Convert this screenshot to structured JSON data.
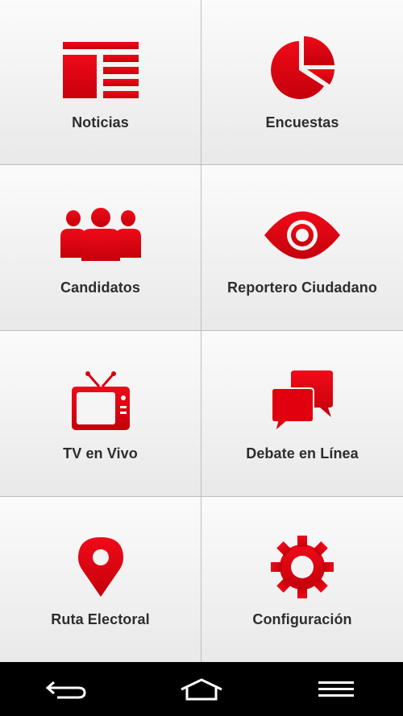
{
  "colors": {
    "accent": "#e3000f",
    "text": "#2d2d2d",
    "navbar": "#000000"
  },
  "tiles": [
    {
      "label": "Noticias",
      "icon": "newspaper-icon"
    },
    {
      "label": "Encuestas",
      "icon": "pie-chart-icon"
    },
    {
      "label": "Candidatos",
      "icon": "people-group-icon"
    },
    {
      "label": "Reportero Ciudadano",
      "icon": "eye-icon"
    },
    {
      "label": "TV en Vivo",
      "icon": "tv-icon"
    },
    {
      "label": "Debate en Línea",
      "icon": "chat-bubbles-icon"
    },
    {
      "label": "Ruta Electoral",
      "icon": "location-pin-icon"
    },
    {
      "label": "Configuración",
      "icon": "gear-icon"
    }
  ],
  "navbar": {
    "buttons": [
      "back-icon",
      "home-icon",
      "menu-icon"
    ]
  }
}
